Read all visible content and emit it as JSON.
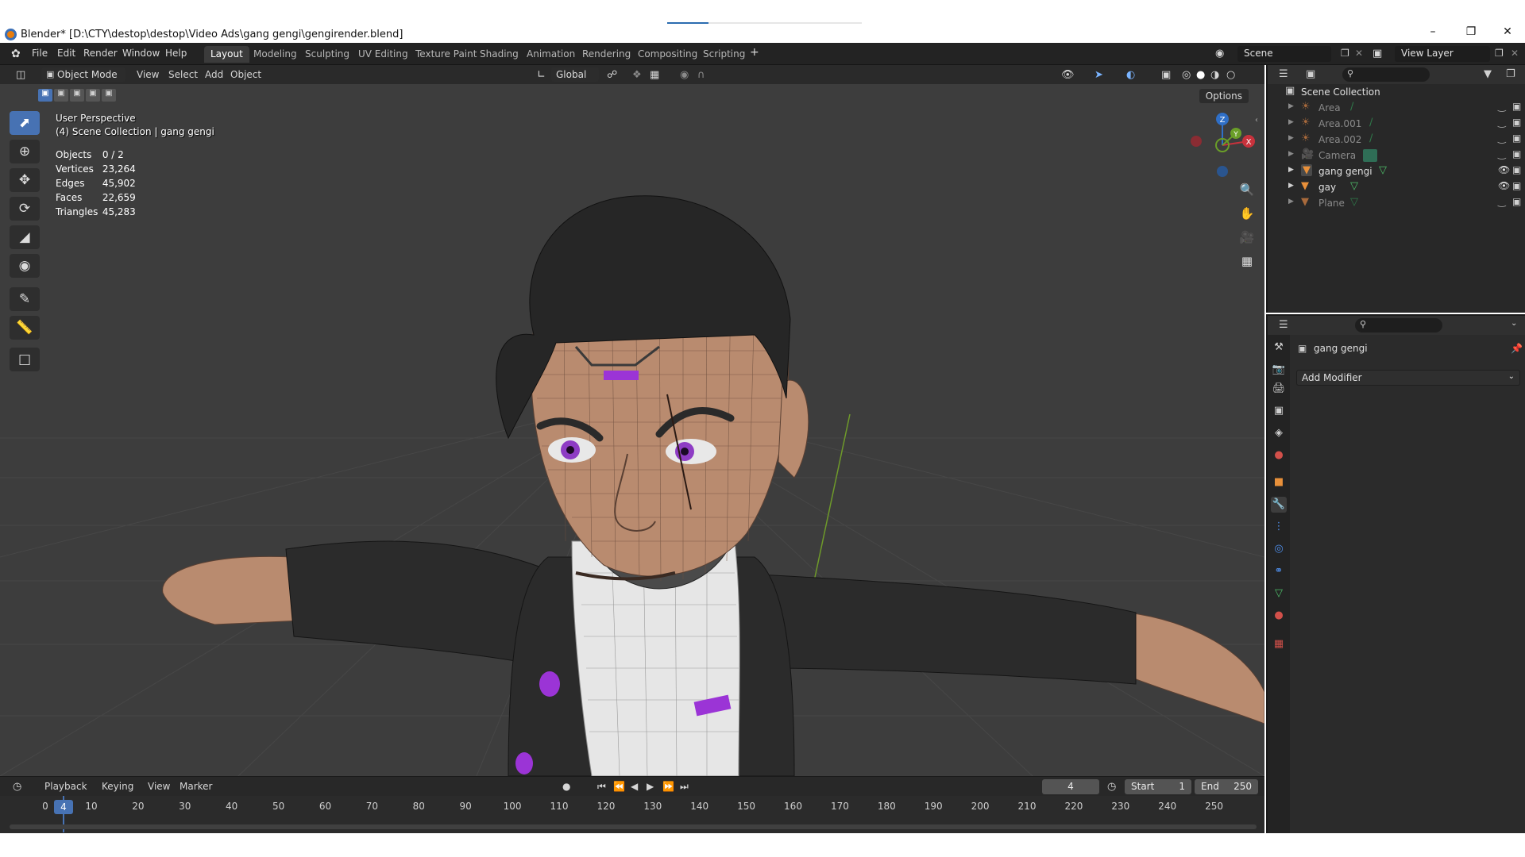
{
  "window": {
    "title": "Blender* [D:\\CTY\\destop\\destop\\Video Ads\\gang gengi\\gengirender.blend]",
    "minimize_icon": "minimize-icon",
    "maximize_icon": "restore-icon",
    "close_icon": "close-icon"
  },
  "menubar": {
    "menus": [
      "File",
      "Edit",
      "Render",
      "Window",
      "Help"
    ],
    "workspaces": [
      "Layout",
      "Modeling",
      "Sculpting",
      "UV Editing",
      "Texture Paint",
      "Shading",
      "Animation",
      "Rendering",
      "Compositing",
      "Scripting"
    ],
    "active_workspace": "Layout",
    "add_workspace": "+",
    "scene": "Scene",
    "view_layer": "View Layer"
  },
  "viewport": {
    "mode": "Object Mode",
    "menus": [
      "View",
      "Select",
      "Add",
      "Object"
    ],
    "orientation": "Global",
    "options_label": "Options",
    "overlay_title": "User Perspective",
    "overlay_collection": "(4) Scene Collection | gang gengi",
    "stats": [
      {
        "label": "Objects",
        "value": "0 / 2"
      },
      {
        "label": "Vertices",
        "value": "23,264"
      },
      {
        "label": "Edges",
        "value": "45,902"
      },
      {
        "label": "Faces",
        "value": "22,659"
      },
      {
        "label": "Triangles",
        "value": "45,283"
      }
    ],
    "gizmo_axes": {
      "x": "X",
      "y": "Y",
      "z": "Z"
    },
    "colors": {
      "background": "#3d3d3d",
      "grid": "#4a4a4a",
      "skin": "#b98b6f",
      "jacket": "#2b2b2b",
      "accent": "#9b34d6"
    }
  },
  "timeline": {
    "menus": [
      "Playback",
      "Keying",
      "View",
      "Marker"
    ],
    "current_frame": "4",
    "start_label": "Start",
    "start_value": "1",
    "end_label": "End",
    "end_value": "250",
    "ruler_ticks": [
      "0",
      "10",
      "20",
      "30",
      "40",
      "50",
      "60",
      "70",
      "80",
      "90",
      "100",
      "110",
      "120",
      "130",
      "140",
      "150",
      "160",
      "170",
      "180",
      "190",
      "200",
      "210",
      "220",
      "230",
      "240",
      "250"
    ]
  },
  "outliner": {
    "root": "Scene Collection",
    "items": [
      {
        "name": "Area",
        "icon": "light-icon",
        "dim": true
      },
      {
        "name": "Area.001",
        "icon": "light-icon",
        "dim": true
      },
      {
        "name": "Area.002",
        "icon": "light-icon",
        "dim": true
      },
      {
        "name": "Camera",
        "icon": "camera-icon",
        "dim": true
      },
      {
        "name": "gang gengi",
        "icon": "mesh-icon",
        "dim": false
      },
      {
        "name": "gay",
        "icon": "mesh-icon",
        "dim": false
      },
      {
        "name": "Plane",
        "icon": "mesh-icon",
        "dim": true
      }
    ]
  },
  "properties": {
    "object_name": "gang gengi",
    "add_modifier": "Add Modifier"
  }
}
